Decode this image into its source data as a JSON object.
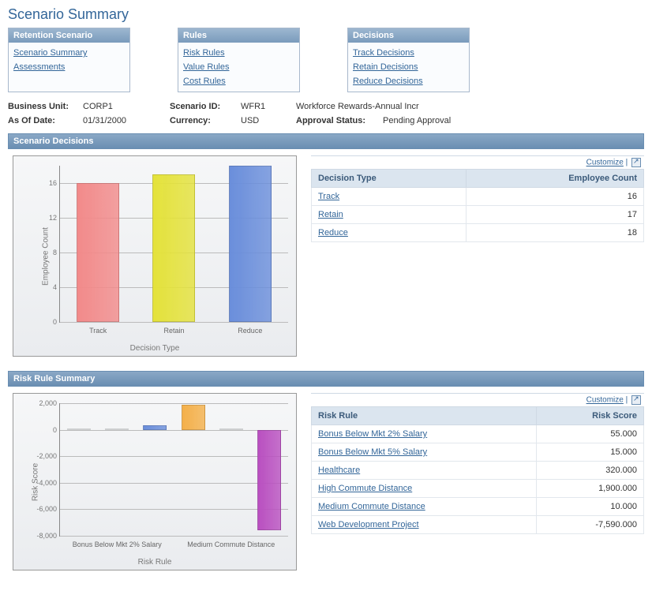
{
  "page_title": "Scenario Summary",
  "nav_panels": [
    {
      "title": "Retention Scenario",
      "links": [
        "Scenario Summary",
        "Assessments"
      ]
    },
    {
      "title": "Rules",
      "links": [
        "Risk Rules",
        "Value Rules",
        "Cost Rules"
      ]
    },
    {
      "title": "Decisions",
      "links": [
        "Track Decisions",
        "Retain Decisions",
        "Reduce Decisions"
      ]
    }
  ],
  "info": {
    "business_unit_label": "Business Unit:",
    "business_unit": "CORP1",
    "scenario_id_label": "Scenario ID:",
    "scenario_id": "WFR1",
    "scenario_desc": "Workforce Rewards-Annual Incr",
    "as_of_date_label": "As Of Date:",
    "as_of_date": "01/31/2000",
    "currency_label": "Currency:",
    "currency": "USD",
    "approval_status_label": "Approval Status:",
    "approval_status": "Pending Approval"
  },
  "tools": {
    "customize": "Customize",
    "sep": " | "
  },
  "sections": {
    "scenario_decisions": {
      "header": "Scenario Decisions",
      "table_headers": [
        "Decision Type",
        "Employee Count"
      ],
      "rows": [
        {
          "label": "Track",
          "value": "16"
        },
        {
          "label": "Retain",
          "value": "17"
        },
        {
          "label": "Reduce",
          "value": "18"
        }
      ]
    },
    "risk_rule_summary": {
      "header": "Risk Rule Summary",
      "table_headers": [
        "Risk Rule",
        "Risk Score"
      ],
      "rows": [
        {
          "label": "Bonus Below Mkt 2% Salary",
          "value": "55.000"
        },
        {
          "label": "Bonus Below Mkt 5% Salary",
          "value": "15.000"
        },
        {
          "label": "Healthcare",
          "value": "320.000"
        },
        {
          "label": "High Commute Distance",
          "value": "1,900.000"
        },
        {
          "label": "Medium Commute Distance",
          "value": "10.000"
        },
        {
          "label": "Web Development Project",
          "value": "-7,590.000"
        }
      ],
      "x_tick_labels": [
        "Bonus Below Mkt 2% Salary",
        "Medium Commute Distance"
      ]
    }
  },
  "chart_data": [
    {
      "type": "bar",
      "title": "",
      "xlabel": "Decision Type",
      "ylabel": "Employee Count",
      "categories": [
        "Track",
        "Retain",
        "Reduce"
      ],
      "values": [
        16,
        17,
        18
      ],
      "y_ticks": [
        0,
        4,
        8,
        12,
        16
      ],
      "ylim": [
        0,
        18
      ],
      "colors": [
        "#f28a8a",
        "#e4e23a",
        "#6a8edb"
      ]
    },
    {
      "type": "bar",
      "title": "",
      "xlabel": "Risk Rule",
      "ylabel": "Risk Score",
      "categories": [
        "Bonus Below Mkt 2% Salary",
        "Bonus Below Mkt 5% Salary",
        "Healthcare",
        "High Commute Distance",
        "Medium Commute Distance",
        "Web Development Project"
      ],
      "values": [
        55,
        15,
        320,
        1900,
        10,
        -7590
      ],
      "y_ticks": [
        -8000,
        -6000,
        -4000,
        -2000,
        0,
        2000
      ],
      "ylim": [
        -8000,
        2000
      ],
      "colors": [
        "#f28a8a",
        "#e4e23a",
        "#6a8edb",
        "#f4b04a",
        "#6a8edb",
        "#b94fc0"
      ]
    }
  ]
}
